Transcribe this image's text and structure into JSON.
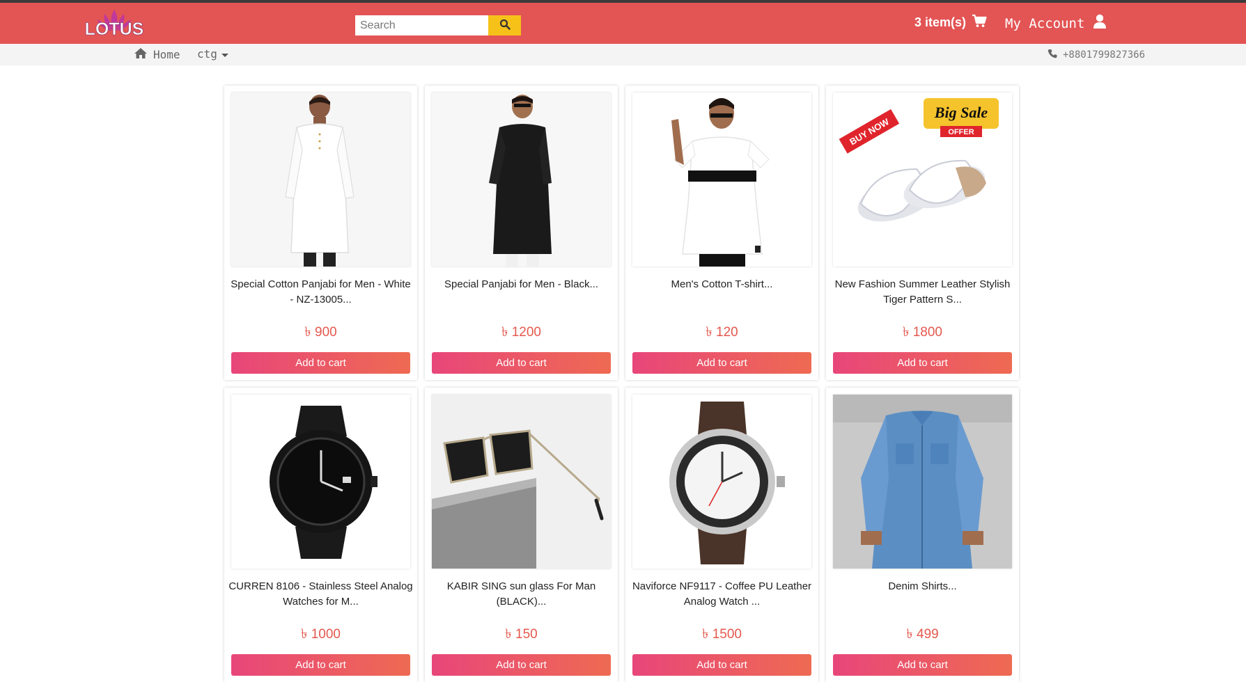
{
  "brand": {
    "logo_text": "LOTUS"
  },
  "search": {
    "placeholder": "Search"
  },
  "header": {
    "cart_label": "3 item(s)",
    "account_label": "My Account"
  },
  "subnav": {
    "home_label": "Home",
    "ctg_label": "ctg",
    "phone": "+8801799827366"
  },
  "currency": "৳",
  "products": [
    {
      "name": "Special Cotton Panjabi for Men - White - NZ-13005...",
      "price": "900",
      "button": "Add to cart"
    },
    {
      "name": "Special Panjabi for Men - Black...",
      "price": "1200",
      "button": "Add to cart"
    },
    {
      "name": "Men's Cotton T-shirt...",
      "price": "120",
      "button": "Add to cart"
    },
    {
      "name": "New Fashion Summer Leather Stylish Tiger Pattern S...",
      "price": "1800",
      "button": "Add to cart",
      "badges": [
        "BUY NOW",
        "Big Sale",
        "OFFER"
      ]
    },
    {
      "name": "CURREN 8106 - Stainless Steel Analog Watches for M...",
      "price": "1000",
      "button": "Add to cart"
    },
    {
      "name": "KABIR SING sun glass For Man (BLACK)...",
      "price": "150",
      "button": "Add to cart"
    },
    {
      "name": "Naviforce NF9117 - Coffee PU Leather Analog Watch ...",
      "price": "1500",
      "button": "Add to cart"
    },
    {
      "name": "Denim Shirts...",
      "price": "499",
      "button": "Add to cart"
    }
  ],
  "colors": {
    "header": "#e35454",
    "price": "#e4584d",
    "search_button": "#f6c21a"
  }
}
